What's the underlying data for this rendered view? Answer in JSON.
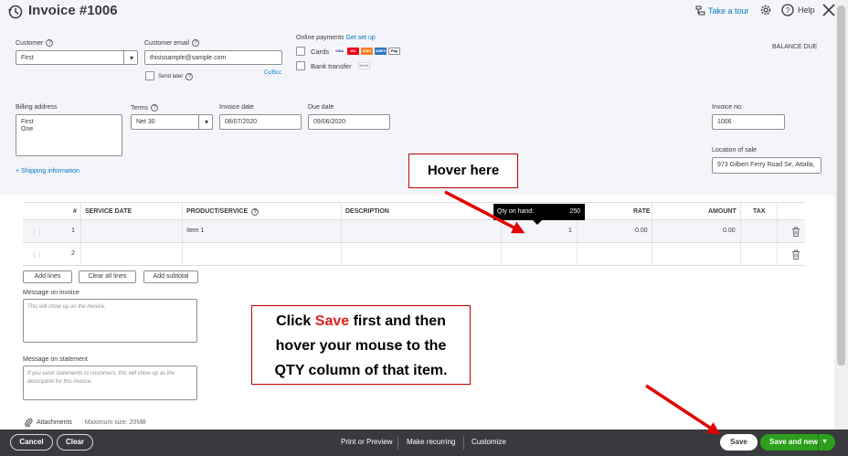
{
  "header": {
    "title": "Invoice #1006",
    "take_tour": "Take a tour",
    "help": "Help"
  },
  "customer": {
    "label": "Customer",
    "value": "First"
  },
  "customer_email": {
    "label": "Customer email",
    "value": "thisissample@sample.com",
    "send_later": "Send later",
    "cc_bcc": "Cc/Bcc"
  },
  "online_payments": {
    "label": "Online payments",
    "get_set_up": "Get set up",
    "cards": "Cards",
    "card_brands": [
      "VISA",
      "MC",
      "DISC",
      "AMEX",
      "Pay"
    ],
    "bank_transfer": "Bank transfer",
    "bank_badge": "BANK"
  },
  "balance_due": "BALANCE DUE",
  "billing_address": {
    "label": "Billing address",
    "line1": "First",
    "line2": "One"
  },
  "terms": {
    "label": "Terms",
    "value": "Net 30"
  },
  "invoice_date": {
    "label": "Invoice date",
    "value": "08/07/2020"
  },
  "due_date": {
    "label": "Due date",
    "value": "09/06/2020"
  },
  "invoice_no": {
    "label": "Invoice no.",
    "value": "1006"
  },
  "location_of_sale": {
    "label": "Location of sale",
    "value": "973 Gilbert Ferry Road Se, Attalla,"
  },
  "shipping_link": "+ Shipping information",
  "table": {
    "headers": {
      "num": "#",
      "service_date": "SERVICE DATE",
      "product": "PRODUCT/SERVICE",
      "description": "DESCRIPTION",
      "rate": "RATE",
      "amount": "AMOUNT",
      "tax": "TAX"
    },
    "rows": [
      {
        "num": "1",
        "product": "Item 1",
        "qty": "1",
        "rate": "0.00",
        "amount": "0.00"
      },
      {
        "num": "2",
        "product": "",
        "qty": "",
        "rate": "",
        "amount": ""
      }
    ],
    "tooltip": {
      "label": "Qty on hand:",
      "value": "250"
    }
  },
  "table_buttons": {
    "add_lines": "Add lines",
    "clear_all_lines": "Clear all lines",
    "add_subtotal": "Add subtotal"
  },
  "message_invoice": {
    "label": "Message on invoice",
    "placeholder": "This will show up on the invoice."
  },
  "message_statement": {
    "label": "Message on statement",
    "placeholder": "If you send statements to customers, this will show up as the description for this invoice."
  },
  "attachments": {
    "label": "Attachments",
    "max_size": "Maximum size: 20MB"
  },
  "callouts": {
    "hover": "Hover here",
    "instruction_pre": "Click ",
    "instruction_save": "Save",
    "instruction_line1_post": " first and then",
    "instruction_line2": "hover your mouse to the",
    "instruction_line3": "QTY column of that item."
  },
  "footer": {
    "cancel": "Cancel",
    "clear": "Clear",
    "print_preview": "Print or Preview",
    "make_recurring": "Make recurring",
    "customize": "Customize",
    "save": "Save",
    "save_and_new": "Save and new"
  },
  "colors": {
    "accent_link": "#0077c5",
    "save_green": "#2ca01c",
    "footer_bg": "#393a3d",
    "callout_red": "#e02020"
  }
}
